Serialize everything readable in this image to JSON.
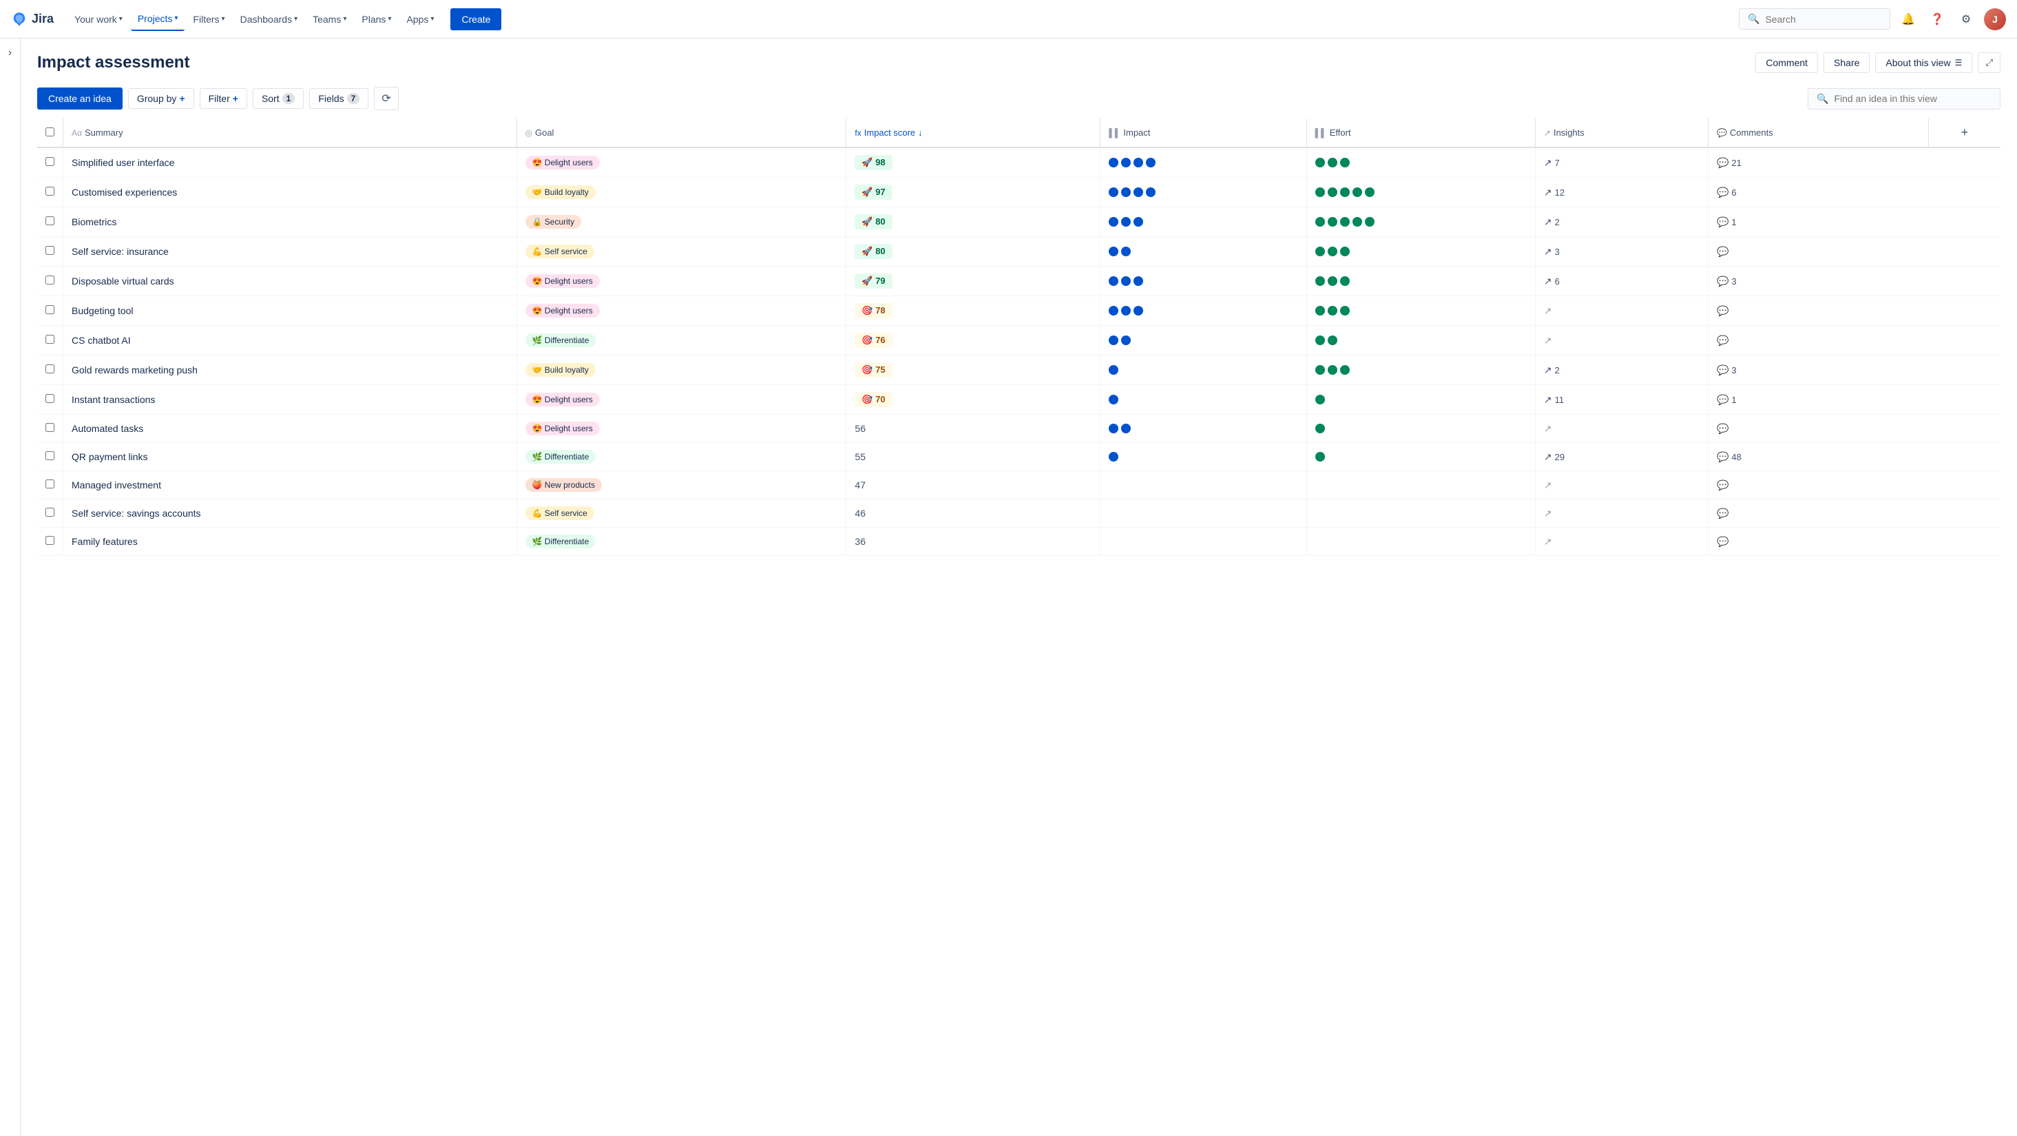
{
  "topnav": {
    "logo_text": "Jira",
    "links": [
      {
        "label": "Your work",
        "active": false
      },
      {
        "label": "Projects",
        "active": true
      },
      {
        "label": "Filters",
        "active": false
      },
      {
        "label": "Dashboards",
        "active": false
      },
      {
        "label": "Teams",
        "active": false
      },
      {
        "label": "Plans",
        "active": false
      },
      {
        "label": "Apps",
        "active": false
      }
    ],
    "create_label": "Create",
    "search_placeholder": "Search",
    "icons": [
      "bell",
      "help",
      "settings"
    ]
  },
  "view": {
    "title": "Impact assessment",
    "comment_btn": "Comment",
    "share_btn": "Share",
    "about_btn": "About this view",
    "toolbar": {
      "create_idea": "Create an idea",
      "group_by": "Group by",
      "filter": "Filter",
      "sort": "Sort",
      "sort_count": "1",
      "fields": "Fields",
      "fields_count": "7",
      "search_placeholder": "Find an idea in this view"
    }
  },
  "table": {
    "columns": [
      {
        "key": "check",
        "label": ""
      },
      {
        "key": "summary",
        "label": "Summary",
        "icon": "text"
      },
      {
        "key": "goal",
        "label": "Goal",
        "icon": "goal"
      },
      {
        "key": "score",
        "label": "Impact score",
        "icon": "fx",
        "sorted": true
      },
      {
        "key": "impact",
        "label": "Impact",
        "icon": "bar"
      },
      {
        "key": "effort",
        "label": "Effort",
        "icon": "bar"
      },
      {
        "key": "insights",
        "label": "Insights",
        "icon": "trend"
      },
      {
        "key": "comments",
        "label": "Comments",
        "icon": "comment"
      }
    ],
    "rows": [
      {
        "summary": "Simplified user interface",
        "goal_emoji": "😍",
        "goal_label": "Delight users",
        "goal_color": "#ffe2f0",
        "score": 98,
        "score_tier": "high",
        "impact_dots": 4,
        "effort_dots": 3,
        "insights": "7",
        "comments": "21"
      },
      {
        "summary": "Customised experiences",
        "goal_emoji": "🤝",
        "goal_label": "Build loyalty",
        "goal_color": "#fff3cd",
        "score": 97,
        "score_tier": "high",
        "impact_dots": 4,
        "effort_dots": 5,
        "insights": "12",
        "comments": "6"
      },
      {
        "summary": "Biometrics",
        "goal_emoji": "🔒",
        "goal_label": "Security",
        "goal_color": "#ffe2d6",
        "score": 80,
        "score_tier": "high",
        "impact_dots": 3,
        "effort_dots": 5,
        "insights": "2",
        "comments": "1"
      },
      {
        "summary": "Self service: insurance",
        "goal_emoji": "💪",
        "goal_label": "Self service",
        "goal_color": "#fff3cd",
        "score": 80,
        "score_tier": "high",
        "impact_dots": 2,
        "effort_dots": 3,
        "insights": "3",
        "comments": ""
      },
      {
        "summary": "Disposable virtual cards",
        "goal_emoji": "😍",
        "goal_label": "Delight users",
        "goal_color": "#ffe2f0",
        "score": 79,
        "score_tier": "high",
        "impact_dots": 3,
        "effort_dots": 3,
        "insights": "6",
        "comments": "3"
      },
      {
        "summary": "Budgeting tool",
        "goal_emoji": "😍",
        "goal_label": "Delight users",
        "goal_color": "#ffe2f0",
        "score": 78,
        "score_tier": "med",
        "impact_dots": 3,
        "effort_dots": 3,
        "insights": "",
        "comments": ""
      },
      {
        "summary": "CS chatbot AI",
        "goal_emoji": "🌿",
        "goal_label": "Differentiate",
        "goal_color": "#e3fcef",
        "score": 76,
        "score_tier": "med",
        "impact_dots": 2,
        "effort_dots": 2,
        "insights": "",
        "comments": ""
      },
      {
        "summary": "Gold rewards marketing push",
        "goal_emoji": "🤝",
        "goal_label": "Build loyalty",
        "goal_color": "#fff3cd",
        "score": 75,
        "score_tier": "med",
        "impact_dots": 1,
        "effort_dots": 3,
        "insights": "2",
        "comments": "3"
      },
      {
        "summary": "Instant transactions",
        "goal_emoji": "😍",
        "goal_label": "Delight users",
        "goal_color": "#ffe2f0",
        "score": 70,
        "score_tier": "med",
        "impact_dots": 1,
        "effort_dots": 1,
        "insights": "11",
        "comments": "1"
      },
      {
        "summary": "Automated tasks",
        "goal_emoji": "😍",
        "goal_label": "Delight users",
        "goal_color": "#ffe2f0",
        "score": 56,
        "score_tier": "low",
        "impact_dots": 2,
        "effort_dots": 1,
        "insights": "",
        "comments": ""
      },
      {
        "summary": "QR payment links",
        "goal_emoji": "🌿",
        "goal_label": "Differentiate",
        "goal_color": "#e3fcef",
        "score": 55,
        "score_tier": "low",
        "impact_dots": 1,
        "effort_dots": 1,
        "insights": "29",
        "comments": "48"
      },
      {
        "summary": "Managed investment",
        "goal_emoji": "🍑",
        "goal_label": "New products",
        "goal_color": "#fce0d6",
        "score": 47,
        "score_tier": "low",
        "impact_dots": 0,
        "effort_dots": 0,
        "insights": "",
        "comments": ""
      },
      {
        "summary": "Self service: savings accounts",
        "goal_emoji": "💪",
        "goal_label": "Self service",
        "goal_color": "#fff3cd",
        "score": 46,
        "score_tier": "low",
        "impact_dots": 0,
        "effort_dots": 0,
        "insights": "",
        "comments": ""
      },
      {
        "summary": "Family features",
        "goal_emoji": "🌿",
        "goal_label": "Differentiate",
        "goal_color": "#e3fcef",
        "score": 36,
        "score_tier": "low",
        "impact_dots": 0,
        "effort_dots": 0,
        "insights": "",
        "comments": ""
      }
    ]
  }
}
